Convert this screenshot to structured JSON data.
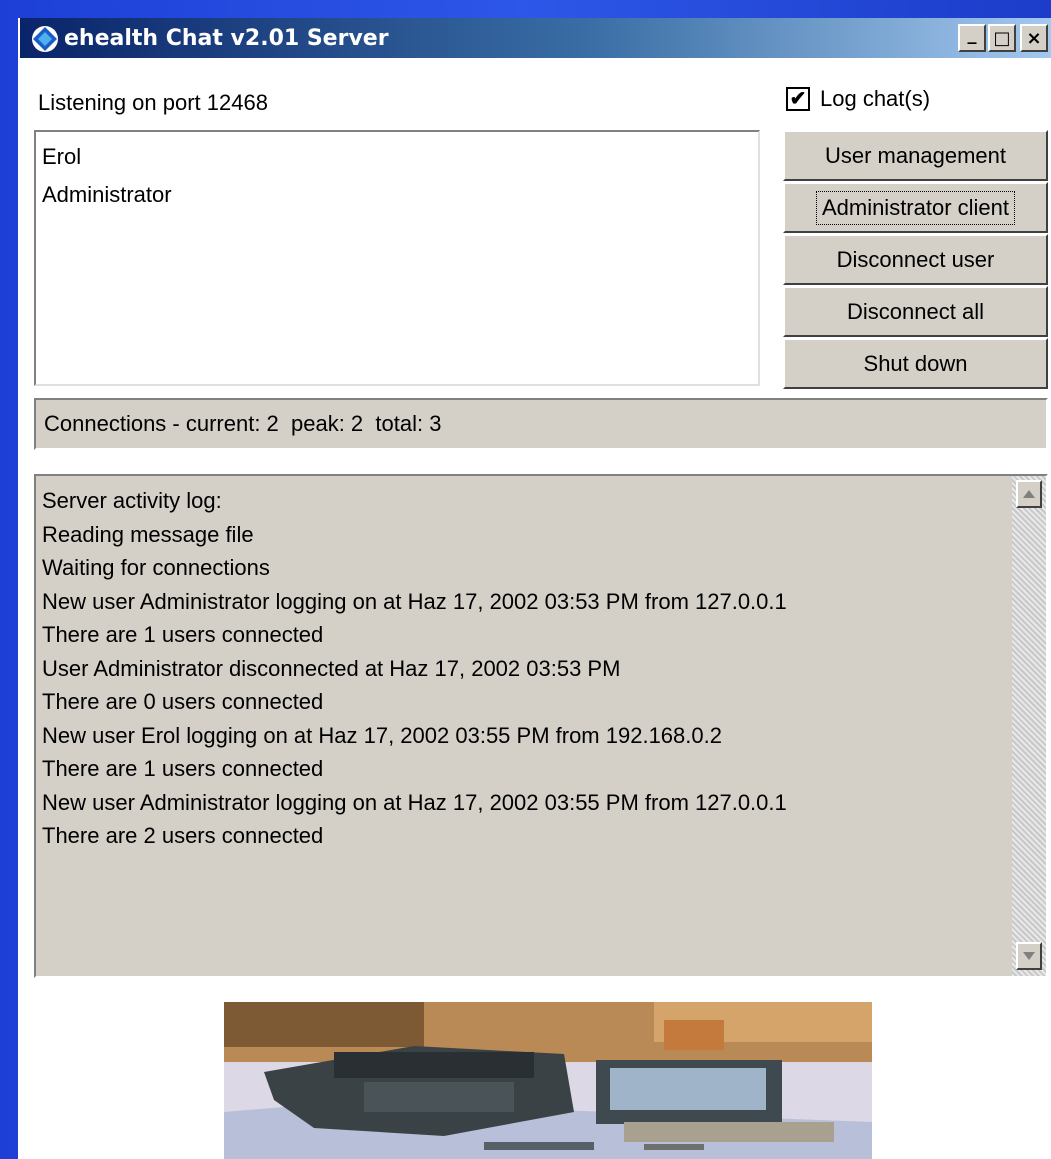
{
  "window": {
    "title": "ehealth Chat v2.01 Server",
    "minimize_label": "_",
    "maximize_label": "□",
    "close_label": "×"
  },
  "server": {
    "port_label": "Listening on port 12468",
    "log_chats_label": "Log chat(s)",
    "log_chats_checked": true
  },
  "users": [
    "Erol",
    "Administrator"
  ],
  "buttons": {
    "user_management": "User management",
    "administrator_client": "Administrator client",
    "disconnect_user": "Disconnect user",
    "disconnect_all": "Disconnect all",
    "shut_down": "Shut down"
  },
  "status": {
    "connections": "Connections - current: 2  peak: 2  total: 3"
  },
  "activity_log": [
    "Server activity log:",
    "Reading message file",
    "Waiting for connections",
    "New user Administrator logging on at Haz 17, 2002 03:53 PM from 127.0.0.1",
    "There are 1 users connected",
    "User Administrator disconnected at Haz 17, 2002 03:53 PM",
    "There are 0 users connected",
    "New user Erol logging on at Haz 17, 2002 03:55 PM from 192.168.0.2",
    "There are 1 users connected",
    "New user Administrator logging on at Haz 17, 2002 03:55 PM from 127.0.0.1",
    "There are 2 users connected"
  ],
  "colors": {
    "titlebar_start": "#0a246a",
    "titlebar_end": "#a6caf0",
    "panel": "#d4d0c8",
    "desktop": "#2d57e8"
  },
  "icons": {
    "app": "diamond-app-icon",
    "scroll_up": "scroll-up-arrow-icon",
    "scroll_down": "scroll-down-arrow-icon"
  }
}
